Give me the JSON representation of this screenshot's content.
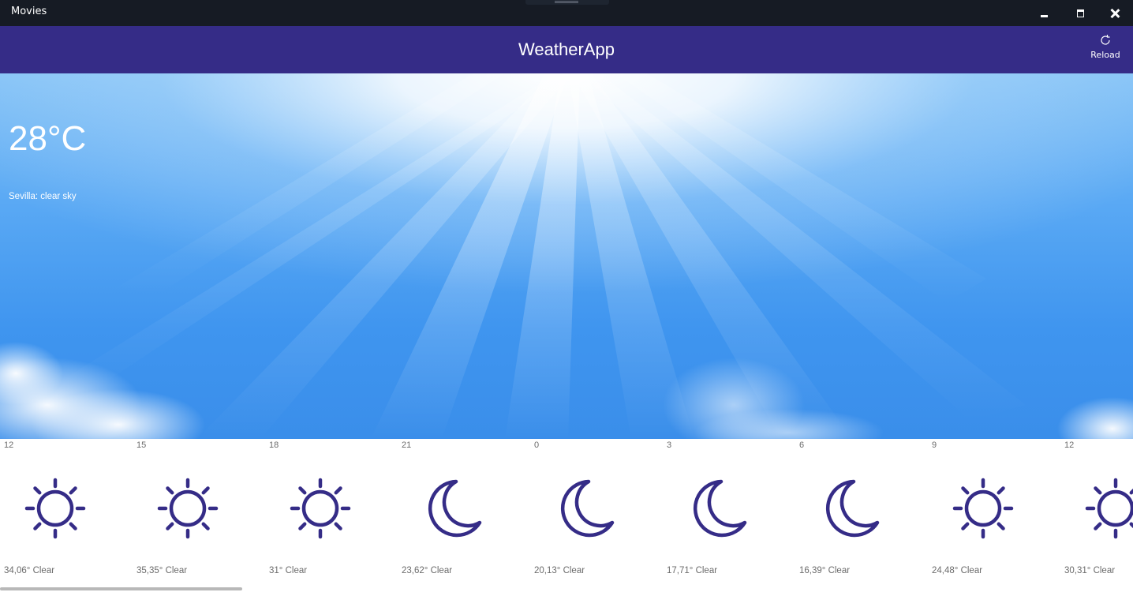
{
  "window": {
    "title": "Movies"
  },
  "header": {
    "title": "WeatherApp",
    "reload_label": "Reload"
  },
  "current": {
    "temperature": "28°C",
    "description": "Sevilla: clear sky"
  },
  "forecast": [
    {
      "hour": "12",
      "summary": "34,06° Clear",
      "icon": "sun-icon"
    },
    {
      "hour": "15",
      "summary": "35,35° Clear",
      "icon": "sun-icon"
    },
    {
      "hour": "18",
      "summary": "31° Clear",
      "icon": "sun-icon"
    },
    {
      "hour": "21",
      "summary": "23,62° Clear",
      "icon": "moon-icon"
    },
    {
      "hour": "0",
      "summary": "20,13° Clear",
      "icon": "moon-icon"
    },
    {
      "hour": "3",
      "summary": "17,71° Clear",
      "icon": "moon-icon"
    },
    {
      "hour": "6",
      "summary": "16,39° Clear",
      "icon": "moon-icon"
    },
    {
      "hour": "9",
      "summary": "24,48° Clear",
      "icon": "sun-icon"
    },
    {
      "hour": "12",
      "summary": "30,31° Clear",
      "icon": "sun-icon"
    }
  ],
  "colors": {
    "titlebar": "#161b24",
    "appbar": "#352c87",
    "icon_stroke": "#352c87",
    "forecast_text": "#6b6b6b"
  }
}
